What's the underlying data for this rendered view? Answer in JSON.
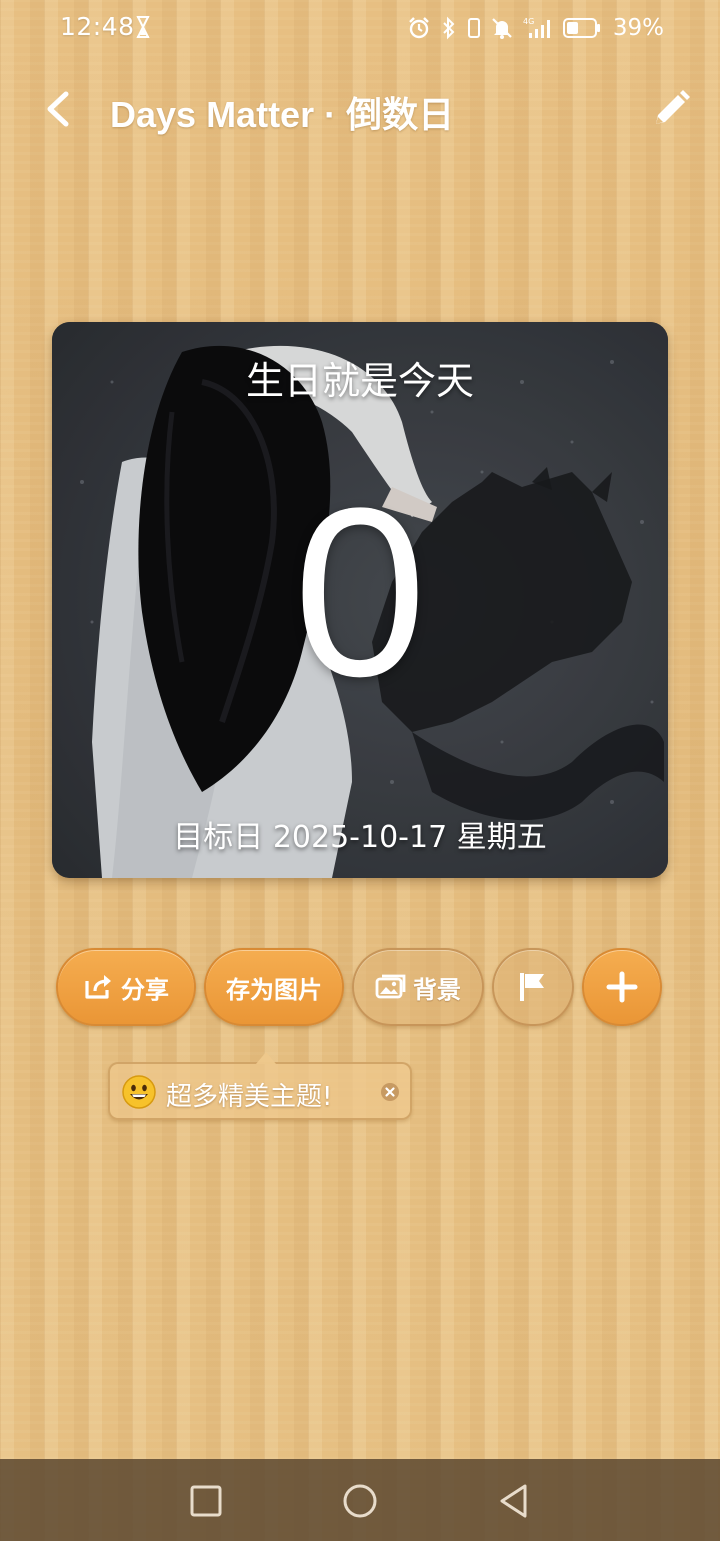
{
  "status_bar": {
    "time": "12:48",
    "battery": "39%",
    "icons": [
      "hourglass-icon",
      "alarm-icon",
      "bluetooth-icon",
      "vibrate-icon",
      "mute-icon",
      "signal-4g-icon",
      "battery-icon"
    ]
  },
  "header": {
    "title": "Days Matter · 倒数日",
    "back_icon": "chevron-left-icon",
    "edit_icon": "pencil-icon"
  },
  "card": {
    "title": "生日就是今天",
    "days": "0",
    "target_date": "目标日 2025-10-17 星期五"
  },
  "actions": {
    "share_label": "分享",
    "save_image_label": "存为图片",
    "background_label": "背景",
    "flag_icon": "flag-icon",
    "add_icon": "plus-icon"
  },
  "promo": {
    "emoji": "grinning-face-icon",
    "text": "超多精美主题!",
    "close_icon": "close-circle-icon"
  },
  "nav": {
    "icons": [
      "recents-square-icon",
      "home-circle-icon",
      "back-triangle-icon"
    ]
  },
  "colors": {
    "accent_orange": "#F09A3A",
    "wood": "#E5BD7F",
    "text": "#FFFFFF"
  }
}
